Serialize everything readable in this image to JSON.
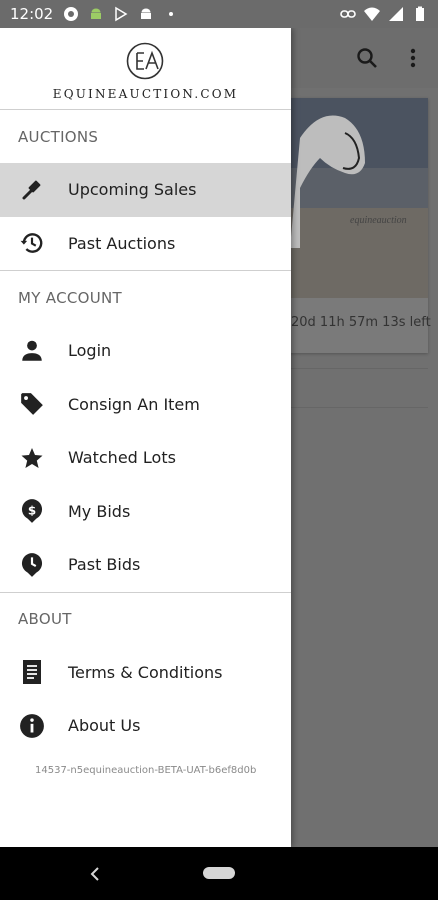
{
  "status_bar": {
    "time": "12:02",
    "left_icons": [
      "record-icon",
      "android-icon",
      "play-store-icon",
      "android-icon",
      "dot-icon"
    ],
    "right_icons": [
      "link-icon",
      "wifi-icon",
      "signal-icon",
      "battery-icon"
    ]
  },
  "background_app": {
    "toolbar_icons": [
      "search-icon",
      "more-vert-icon"
    ],
    "card_time_left": "20d 11h 57m 13s left",
    "card_image_text": "equineauction"
  },
  "drawer": {
    "logo_text": "EQUINEAUCTION.COM",
    "sections": [
      {
        "title": "AUCTIONS",
        "items": [
          {
            "label": "Upcoming Sales",
            "icon": "gavel-icon",
            "active": true
          },
          {
            "label": "Past Auctions",
            "icon": "history-icon",
            "active": false
          }
        ]
      },
      {
        "title": "MY ACCOUNT",
        "items": [
          {
            "label": "Login",
            "icon": "person-icon"
          },
          {
            "label": "Consign An Item",
            "icon": "tag-icon"
          },
          {
            "label": "Watched Lots",
            "icon": "star-icon"
          },
          {
            "label": "My Bids",
            "icon": "dollar-pin-icon"
          },
          {
            "label": "Past Bids",
            "icon": "clock-pin-icon"
          }
        ]
      },
      {
        "title": "ABOUT",
        "items": [
          {
            "label": "Terms & Conditions",
            "icon": "document-icon"
          },
          {
            "label": "About Us",
            "icon": "info-icon"
          }
        ]
      }
    ],
    "build_text": "14537-n5equineauction-BETA-UAT-b6ef8d0b"
  },
  "nav_bar": {
    "icons": [
      "back-icon",
      "home-pill-icon"
    ]
  }
}
